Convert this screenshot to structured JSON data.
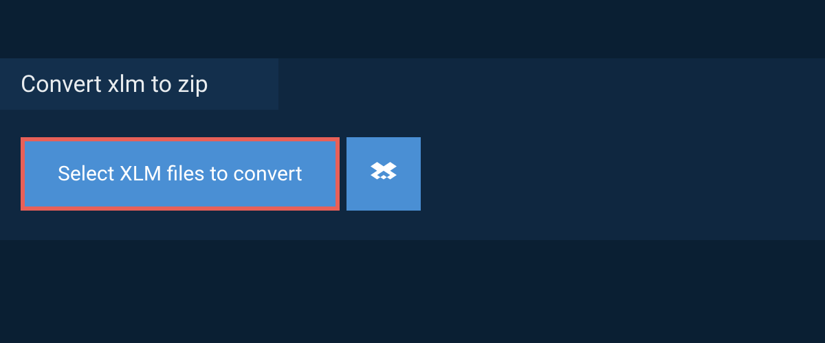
{
  "header": {
    "title": "Convert xlm to zip"
  },
  "actions": {
    "select_label": "Select XLM files to convert",
    "dropbox_icon": "dropbox-icon"
  },
  "colors": {
    "background_dark": "#0a1f33",
    "background_mid": "#0f2740",
    "tab_bg": "#132f4c",
    "button_bg": "#4a8fd4",
    "button_border": "#e86058",
    "text_light": "#e8ecef",
    "text_white": "#ffffff"
  }
}
